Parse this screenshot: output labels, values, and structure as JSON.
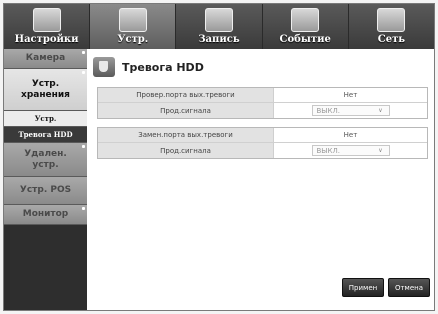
{
  "tabs": [
    {
      "label": "Настройки",
      "icon": "monitor-icon",
      "active": false
    },
    {
      "label": "Устр.",
      "icon": "device-icon",
      "active": true
    },
    {
      "label": "Запись",
      "icon": "record-icon",
      "active": false
    },
    {
      "label": "Событие",
      "icon": "event-icon",
      "active": false
    },
    {
      "label": "Сеть",
      "icon": "network-icon",
      "active": false
    }
  ],
  "sidebar": {
    "camera": "Камера",
    "storage": "Устр. хранения",
    "storage_sub": "Устр.",
    "storage_sub_hdd": "Тревога HDD",
    "remote": "Удален. устр.",
    "pos": "Устр. POS",
    "monitor": "Монитор"
  },
  "page": {
    "title": "Тревога HDD",
    "rows": [
      {
        "label": "Провер.порта вых.тревоги",
        "value": "Нет"
      },
      {
        "label": "Прод.сигнала",
        "value": "ВЫКЛ."
      },
      {
        "label": "Замен.порта вых.тревоги",
        "value": "Нет"
      },
      {
        "label": "Прод.сигнала",
        "value": "ВЫКЛ."
      }
    ],
    "chevron": "∨"
  },
  "buttons": {
    "apply": "Примен",
    "cancel": "Отмена"
  }
}
